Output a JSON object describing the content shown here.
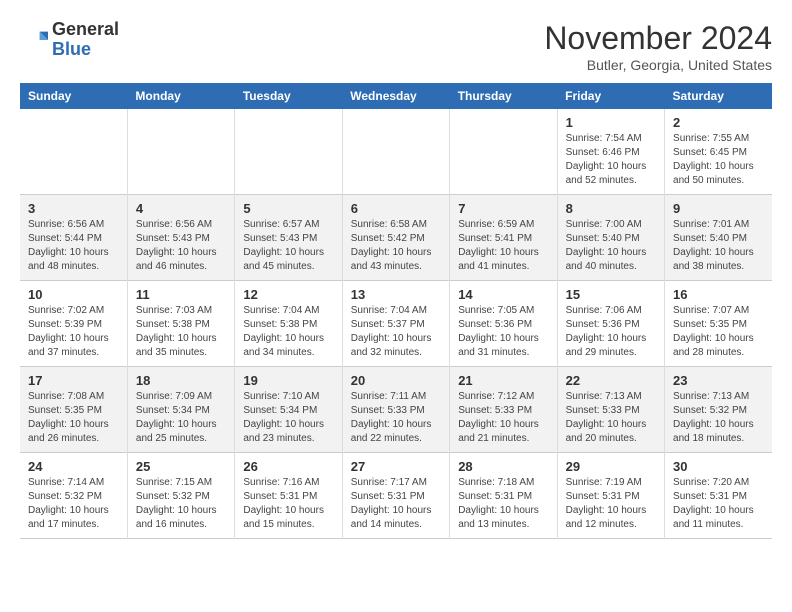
{
  "header": {
    "logo_line1": "General",
    "logo_line2": "Blue",
    "month": "November 2024",
    "location": "Butler, Georgia, United States"
  },
  "weekdays": [
    "Sunday",
    "Monday",
    "Tuesday",
    "Wednesday",
    "Thursday",
    "Friday",
    "Saturday"
  ],
  "weeks": [
    [
      {
        "day": "",
        "info": ""
      },
      {
        "day": "",
        "info": ""
      },
      {
        "day": "",
        "info": ""
      },
      {
        "day": "",
        "info": ""
      },
      {
        "day": "",
        "info": ""
      },
      {
        "day": "1",
        "info": "Sunrise: 7:54 AM\nSunset: 6:46 PM\nDaylight: 10 hours and 52 minutes."
      },
      {
        "day": "2",
        "info": "Sunrise: 7:55 AM\nSunset: 6:45 PM\nDaylight: 10 hours and 50 minutes."
      }
    ],
    [
      {
        "day": "3",
        "info": "Sunrise: 6:56 AM\nSunset: 5:44 PM\nDaylight: 10 hours and 48 minutes."
      },
      {
        "day": "4",
        "info": "Sunrise: 6:56 AM\nSunset: 5:43 PM\nDaylight: 10 hours and 46 minutes."
      },
      {
        "day": "5",
        "info": "Sunrise: 6:57 AM\nSunset: 5:43 PM\nDaylight: 10 hours and 45 minutes."
      },
      {
        "day": "6",
        "info": "Sunrise: 6:58 AM\nSunset: 5:42 PM\nDaylight: 10 hours and 43 minutes."
      },
      {
        "day": "7",
        "info": "Sunrise: 6:59 AM\nSunset: 5:41 PM\nDaylight: 10 hours and 41 minutes."
      },
      {
        "day": "8",
        "info": "Sunrise: 7:00 AM\nSunset: 5:40 PM\nDaylight: 10 hours and 40 minutes."
      },
      {
        "day": "9",
        "info": "Sunrise: 7:01 AM\nSunset: 5:40 PM\nDaylight: 10 hours and 38 minutes."
      }
    ],
    [
      {
        "day": "10",
        "info": "Sunrise: 7:02 AM\nSunset: 5:39 PM\nDaylight: 10 hours and 37 minutes."
      },
      {
        "day": "11",
        "info": "Sunrise: 7:03 AM\nSunset: 5:38 PM\nDaylight: 10 hours and 35 minutes."
      },
      {
        "day": "12",
        "info": "Sunrise: 7:04 AM\nSunset: 5:38 PM\nDaylight: 10 hours and 34 minutes."
      },
      {
        "day": "13",
        "info": "Sunrise: 7:04 AM\nSunset: 5:37 PM\nDaylight: 10 hours and 32 minutes."
      },
      {
        "day": "14",
        "info": "Sunrise: 7:05 AM\nSunset: 5:36 PM\nDaylight: 10 hours and 31 minutes."
      },
      {
        "day": "15",
        "info": "Sunrise: 7:06 AM\nSunset: 5:36 PM\nDaylight: 10 hours and 29 minutes."
      },
      {
        "day": "16",
        "info": "Sunrise: 7:07 AM\nSunset: 5:35 PM\nDaylight: 10 hours and 28 minutes."
      }
    ],
    [
      {
        "day": "17",
        "info": "Sunrise: 7:08 AM\nSunset: 5:35 PM\nDaylight: 10 hours and 26 minutes."
      },
      {
        "day": "18",
        "info": "Sunrise: 7:09 AM\nSunset: 5:34 PM\nDaylight: 10 hours and 25 minutes."
      },
      {
        "day": "19",
        "info": "Sunrise: 7:10 AM\nSunset: 5:34 PM\nDaylight: 10 hours and 23 minutes."
      },
      {
        "day": "20",
        "info": "Sunrise: 7:11 AM\nSunset: 5:33 PM\nDaylight: 10 hours and 22 minutes."
      },
      {
        "day": "21",
        "info": "Sunrise: 7:12 AM\nSunset: 5:33 PM\nDaylight: 10 hours and 21 minutes."
      },
      {
        "day": "22",
        "info": "Sunrise: 7:13 AM\nSunset: 5:33 PM\nDaylight: 10 hours and 20 minutes."
      },
      {
        "day": "23",
        "info": "Sunrise: 7:13 AM\nSunset: 5:32 PM\nDaylight: 10 hours and 18 minutes."
      }
    ],
    [
      {
        "day": "24",
        "info": "Sunrise: 7:14 AM\nSunset: 5:32 PM\nDaylight: 10 hours and 17 minutes."
      },
      {
        "day": "25",
        "info": "Sunrise: 7:15 AM\nSunset: 5:32 PM\nDaylight: 10 hours and 16 minutes."
      },
      {
        "day": "26",
        "info": "Sunrise: 7:16 AM\nSunset: 5:31 PM\nDaylight: 10 hours and 15 minutes."
      },
      {
        "day": "27",
        "info": "Sunrise: 7:17 AM\nSunset: 5:31 PM\nDaylight: 10 hours and 14 minutes."
      },
      {
        "day": "28",
        "info": "Sunrise: 7:18 AM\nSunset: 5:31 PM\nDaylight: 10 hours and 13 minutes."
      },
      {
        "day": "29",
        "info": "Sunrise: 7:19 AM\nSunset: 5:31 PM\nDaylight: 10 hours and 12 minutes."
      },
      {
        "day": "30",
        "info": "Sunrise: 7:20 AM\nSunset: 5:31 PM\nDaylight: 10 hours and 11 minutes."
      }
    ]
  ]
}
